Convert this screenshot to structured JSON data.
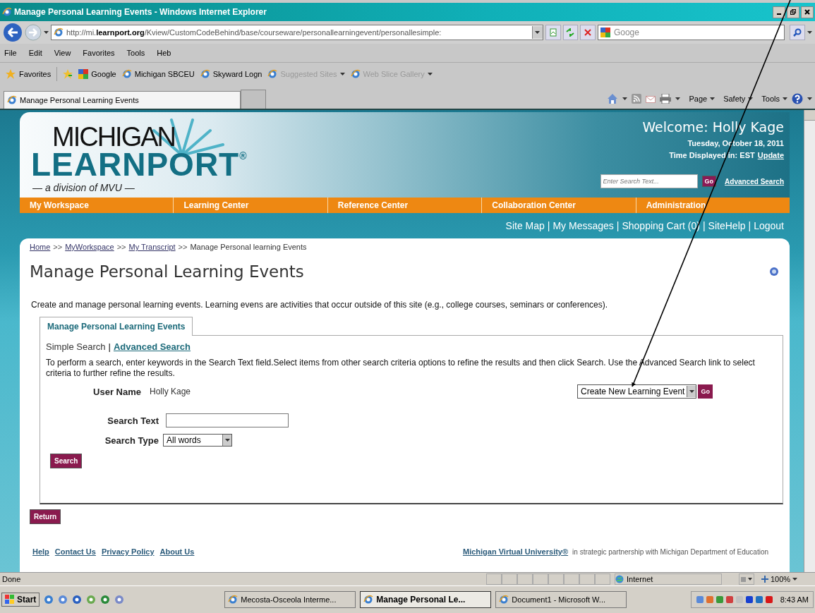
{
  "window": {
    "title": "Manage Personal Learning Events - Windows Internet Explorer"
  },
  "address_bar": {
    "url": "http://mi.**learnport.org**/Kview/CustomCodeBehind/base/courseware/personallearningevent/personallesimple:",
    "search_value": "Googe"
  },
  "menu": [
    "File",
    "Edit",
    "View",
    "Favorites",
    "Tools",
    "Heb"
  ],
  "favorites_bar": {
    "label": "Favorites",
    "items": [
      {
        "label": "Google",
        "kind": "google",
        "disabled": false,
        "dropdown": false
      },
      {
        "label": "Michigan SBCEU",
        "kind": "page",
        "disabled": false,
        "dropdown": false
      },
      {
        "label": "Skyward Logn",
        "kind": "page",
        "disabled": false,
        "dropdown": false
      },
      {
        "label": "Suggested Sites",
        "kind": "page",
        "disabled": true,
        "dropdown": true
      },
      {
        "label": "Web Slice Gallery",
        "kind": "page",
        "disabled": true,
        "dropdown": true
      }
    ]
  },
  "browser_tabs": [
    {
      "label": "Manage Personal Learning Events",
      "selected": true
    }
  ],
  "command_bar": [
    "Page",
    "Safety",
    "Tools"
  ],
  "site": {
    "logo": {
      "line1": "MICHIGAN",
      "line2": "LEARNPORT$^{®}$",
      "tagline": "— a division of MVU —"
    },
    "welcome": "Welcome: Holly Kage",
    "date": "Tuesday, October 18, 2011",
    "timezone": "Time Displayed in: EST",
    "update_link": "Update",
    "search_placeholder": "Enter Search Text...",
    "go": "Go",
    "advanced_search": "Advanced Search",
    "nav": [
      "My Workspace",
      "Learning Center",
      "Reference Center",
      "Collaboration Center",
      "Administration"
    ],
    "utility_separator": "|",
    "utility_links": [
      "Site Map",
      "My Messages",
      "Shopping Cart (0)",
      "SiteHelp",
      "Logout"
    ]
  },
  "breadcrumb": {
    "separator": ">>",
    "items": [
      {
        "label": "Home",
        "link": true
      },
      {
        "label": "MyWorkspace",
        "link": true
      },
      {
        "label": "My Transcript",
        "link": true
      },
      {
        "label": "Manage Personal learning Events",
        "link": false
      }
    ]
  },
  "heading": "Manage Personal Learning Events",
  "description": "Create and manage personal learning events. Learning evens are activities that occur outside of this site (e.g., college courses, seminars or conferences).",
  "content_tabs": [
    {
      "label": "Manage Personal Learning Events",
      "selected": true
    }
  ],
  "search_modes": {
    "separator": "|",
    "items": [
      {
        "label": "Simple Search",
        "selected": true
      },
      {
        "label": "Advanced Search",
        "selected": false
      }
    ]
  },
  "instructions": "To perform a search, enter keywords in the Search Text field.Select items from other search criteria options to refine the results and then click Search. Use the Advanced Search link to select criteria to further refine the results.",
  "form": {
    "user_name_label": "User Name",
    "user_name": "Holly Kage",
    "action": "Create New Learning Event",
    "action_go": "Go",
    "search_text_label": "Search Text",
    "search_type_label": "Search Type",
    "search_type": "All words",
    "search_button": "Search"
  },
  "return_button": "Return",
  "footer": {
    "links": [
      "Help",
      "Contact Us",
      "Privacy Policy",
      "About Us"
    ],
    "mvu_link": "Michigan Virtual University®",
    "partner_text": "in strategic partnership with Michigan Department of Education"
  },
  "status_bar": {
    "text": "Done",
    "zone": "Internet",
    "zoom": "100%"
  },
  "taskbar": {
    "start": "Start",
    "windows": [
      {
        "label": "Mecosta-Osceola Interme...",
        "selected": false
      },
      {
        "label": "Manage Personal Le...",
        "selected": true
      },
      {
        "label": "Document1 - Microsoft W...",
        "selected": false
      }
    ],
    "clock": "8:43 AM"
  }
}
